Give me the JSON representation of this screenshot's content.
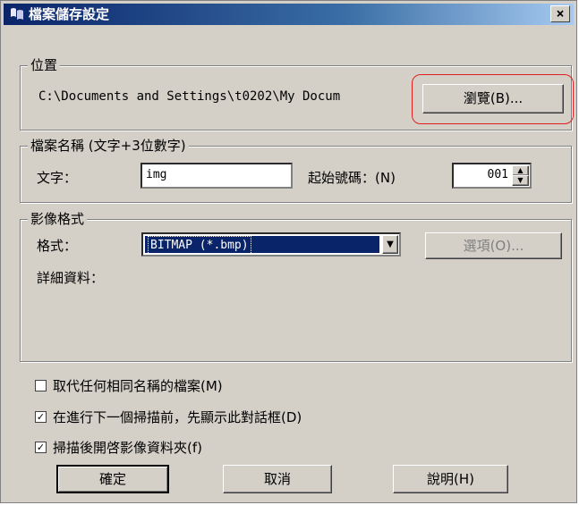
{
  "window": {
    "title": "檔案儲存設定",
    "close_label": "×"
  },
  "location": {
    "legend": "位置",
    "path": "C:\\Documents and Settings\\t0202\\My Docum",
    "browse_label": "瀏覽(B)..."
  },
  "filename": {
    "legend": "檔案名稱 (文字+3位數字)",
    "text_label": "文字：",
    "text_value": "img",
    "start_label": "起始號碼：(N)",
    "start_value": "001"
  },
  "image_format": {
    "legend": "影像格式",
    "format_label": "格式：",
    "format_value": "BITMAP (*.bmp)",
    "options_label": "選項(O)...",
    "detail_label": "詳細資料："
  },
  "checkboxes": [
    {
      "label": "取代任何相同名稱的檔案(M)",
      "checked": false
    },
    {
      "label": "在進行下一個掃描前，先顯示此對話框(D)",
      "checked": true
    },
    {
      "label": "掃描後開啓影像資料夾(f)",
      "checked": true
    }
  ],
  "buttons": {
    "ok": "確定",
    "cancel": "取消",
    "help": "說明(H)"
  },
  "colors": {
    "titlebar_start": "#0a246a",
    "highlight": "#e0201e",
    "selection": "#0a246a"
  }
}
